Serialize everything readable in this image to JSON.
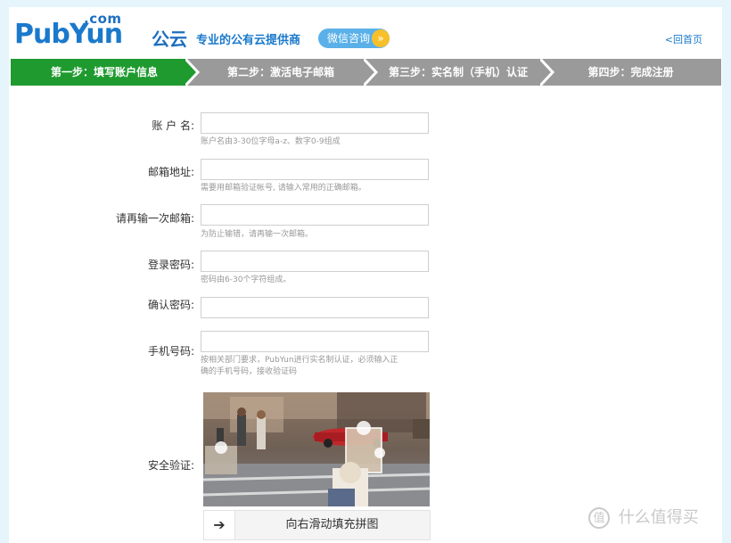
{
  "header": {
    "logo_dotcom": ".com",
    "logo_brand": "PubYun",
    "logo_brand_cn": "公云",
    "tagline": "专业的公有云提供商",
    "wechat_button": "微信咨询",
    "home_link": "<回首页"
  },
  "steps": [
    {
      "label": "第一步：填写账户信息",
      "active": true
    },
    {
      "label": "第二步：激活电子邮箱",
      "active": false
    },
    {
      "label": "第三步：实名制（手机）认证",
      "active": false
    },
    {
      "label": "第四步：完成注册",
      "active": false
    }
  ],
  "colors": {
    "active_step": "#1f9a2f",
    "inactive_step": "#9a9a9a",
    "brand": "#1a79cc"
  },
  "form": {
    "account": {
      "label": "账 户 名:",
      "value": "",
      "hint": "账户名由3-30位字母a-z、数字0-9组成"
    },
    "email": {
      "label": "邮箱地址:",
      "value": "",
      "hint": "需要用邮箱验证帐号, 请输入常用的正确邮箱。"
    },
    "email_confirm": {
      "label": "请再输一次邮箱:",
      "value": "",
      "hint": "为防止输错，请再输一次邮箱。"
    },
    "password": {
      "label": "登录密码:",
      "value": "",
      "hint": "密码由6-30个字符组成。"
    },
    "password_confirm": {
      "label": "确认密码:",
      "value": ""
    },
    "phone": {
      "label": "手机号码:",
      "value": "",
      "hint_line1": "按相关部门要求，PubYun进行实名制认证，必须输入正",
      "hint_line2": "确的手机号码，接收验证码"
    },
    "captcha": {
      "label": "安全验证:",
      "slider_text": "向右滑动填充拼图",
      "slider_icon": "arrow-right-icon"
    }
  },
  "watermark": {
    "text": "什么值得买",
    "icon_text": "值"
  }
}
